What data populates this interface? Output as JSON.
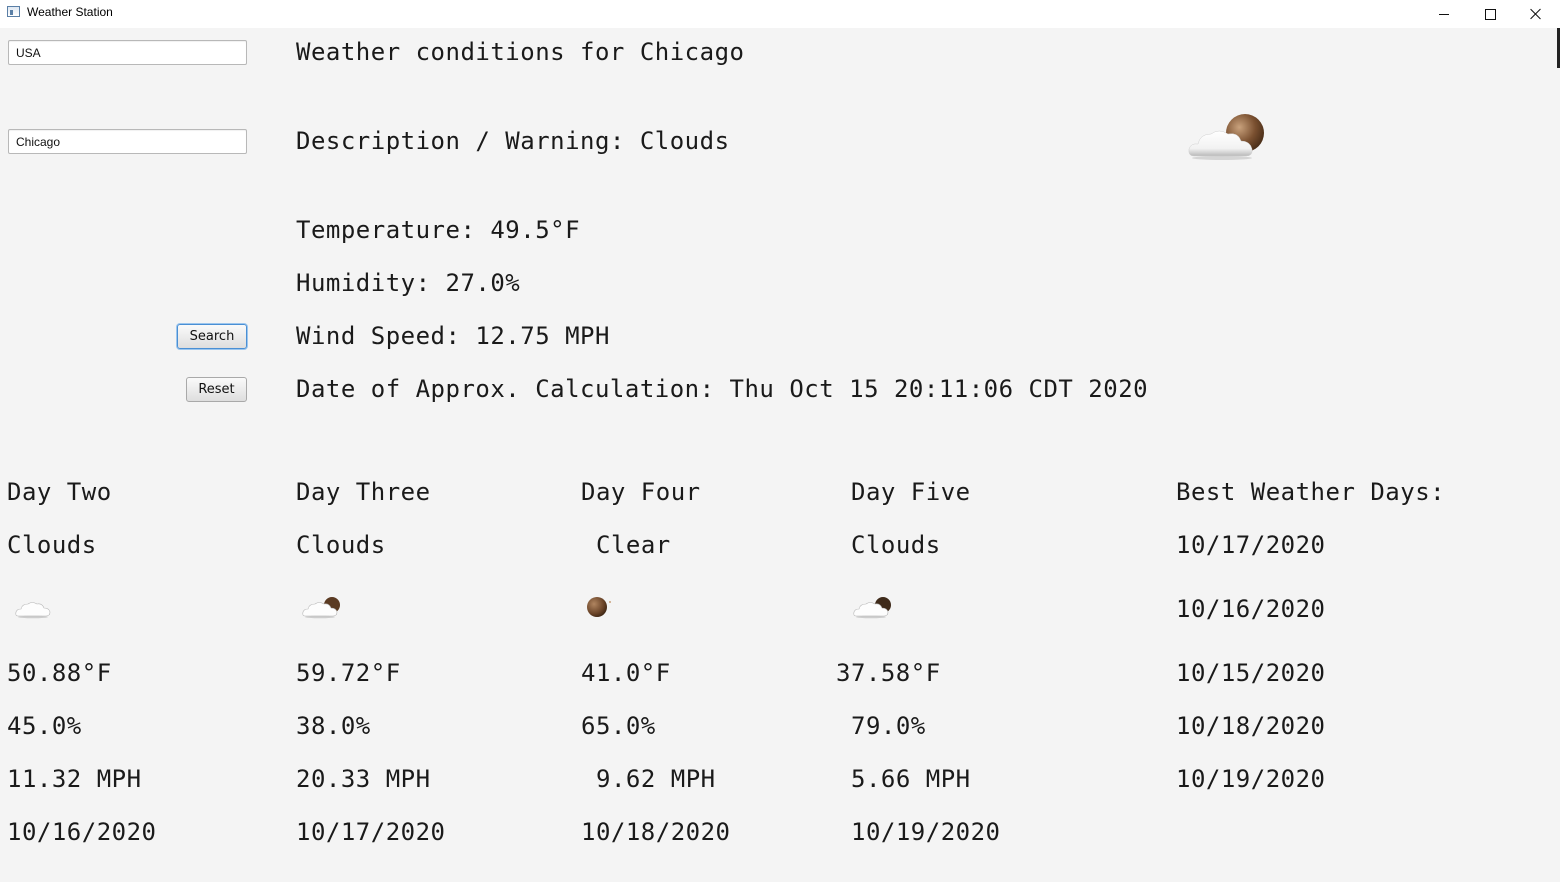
{
  "window": {
    "title": "Weather Station"
  },
  "inputs": {
    "country_value": "USA",
    "city_value": "Chicago"
  },
  "buttons": {
    "search_label": "Search",
    "reset_label": "Reset"
  },
  "current": {
    "heading": "Weather conditions for Chicago",
    "description": "Description / Warning: Clouds",
    "temperature": "Temperature: 49.5°F",
    "humidity": "Humidity: 27.0%",
    "wind": "Wind Speed: 12.75 MPH",
    "date": "Date of Approx. Calculation: Thu Oct 15 20:11:06 CDT 2020",
    "icon": "cloud-with-sun-icon"
  },
  "forecast": [
    {
      "label": "Day Two",
      "condition": "Clouds",
      "icon": "cloud-icon",
      "temperature": "50.88°F",
      "humidity": "45.0%",
      "wind": "11.32 MPH",
      "date": "10/16/2020"
    },
    {
      "label": "Day Three",
      "condition": "Clouds",
      "icon": "cloud-with-sun-icon",
      "temperature": "59.72°F",
      "humidity": "38.0%",
      "wind": "20.33 MPH",
      "date": "10/17/2020"
    },
    {
      "label": "Day Four",
      "condition": "Clear",
      "icon": "sun-icon",
      "temperature": "41.0°F",
      "humidity": "65.0%",
      "wind": "9.62 MPH",
      "date": "10/18/2020"
    },
    {
      "label": "Day Five",
      "condition": "Clouds",
      "icon": "cloud-with-sun-icon",
      "temperature": "37.58°F",
      "humidity": "79.0%",
      "wind": "5.66 MPH",
      "date": "10/19/2020"
    }
  ],
  "best_days": {
    "heading": "Best Weather Days:",
    "dates": [
      "10/17/2020",
      "10/16/2020",
      "10/15/2020",
      "10/18/2020",
      "10/19/2020"
    ]
  }
}
